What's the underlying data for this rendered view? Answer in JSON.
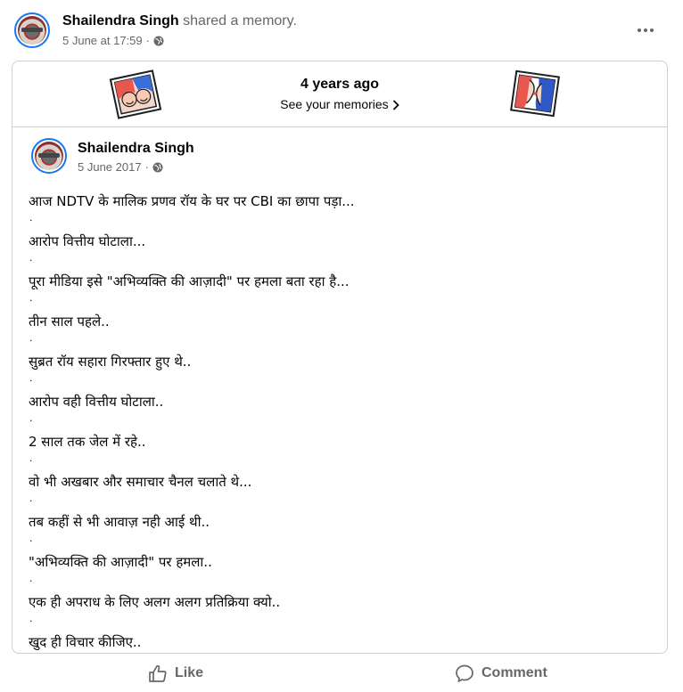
{
  "header": {
    "author": "Shailendra Singh",
    "action": "shared a memory.",
    "date": "5 June at 17:59",
    "separator": "·"
  },
  "memory": {
    "title": "4 years ago",
    "link": "See your memories"
  },
  "original_post": {
    "author": "Shailendra Singh",
    "date": "5 June 2017",
    "separator": "·",
    "line_separator": ".",
    "lines": [
      "आज NDTV के मालिक प्रणव रॉय के घर पर CBI का छापा पड़ा...",
      "आरोप वित्तीय घोटाला...",
      "पूरा मीडिया इसे \"अभिव्यक्ति की आज़ादी\" पर हमला बता रहा है...",
      "तीन साल पहले..",
      "सुब्रत रॉय सहारा गिरफ्तार हुए थे..",
      "आरोप वही वित्तीय घोटाला..",
      "2 साल तक जेल में रहे..",
      "वो भी अखबार और समाचार चैनल चलाते थे...",
      "तब कहीं से भी आवाज़ नही आई थी..",
      "\"अभिव्यक्ति की आज़ादी\" पर हमला..",
      "एक ही अपराध के लिए अलग अलग प्रतिक्रिया क्यो..",
      "खुद ही विचार कीजिए.."
    ]
  },
  "actions": {
    "like": "Like",
    "comment": "Comment"
  },
  "icons": {
    "privacy": "globe-icon",
    "menu": "more-options-icon",
    "memory_left": "faces-sticker-icon",
    "memory_right": "kiss-sticker-icon",
    "like": "thumbs-up-icon",
    "comment": "speech-bubble-icon"
  },
  "colors": {
    "text_primary": "#050505",
    "text_secondary": "#65676b",
    "border": "#ced0d4",
    "avatar_ring": "#1877f2"
  }
}
